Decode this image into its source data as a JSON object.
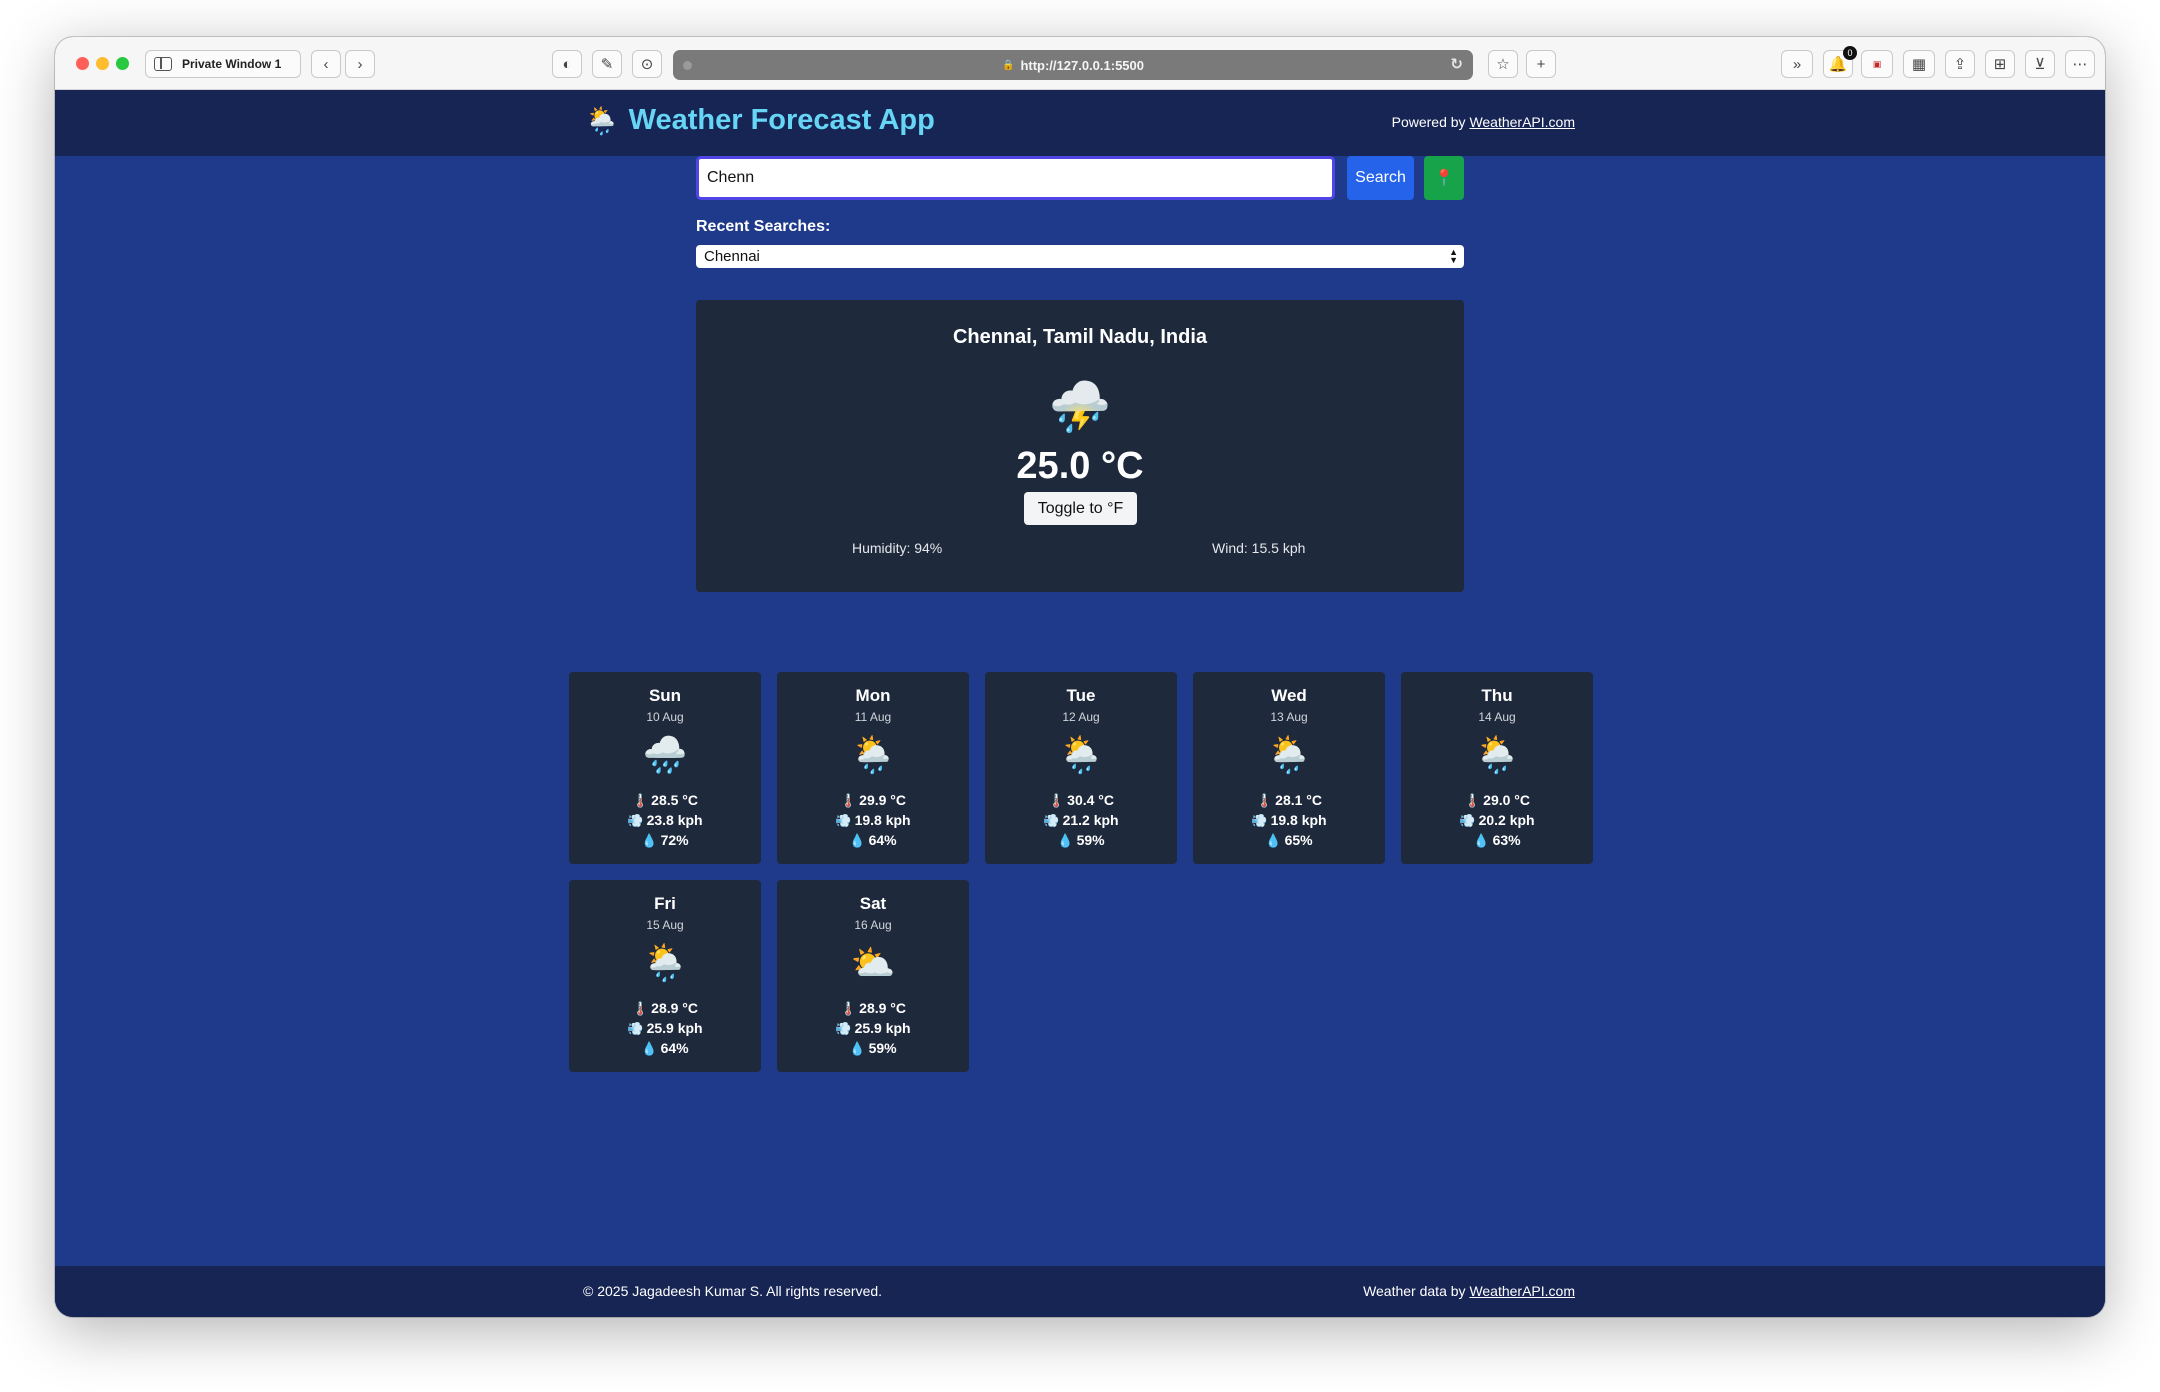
{
  "browser": {
    "tab_label": "Private Window 1",
    "url": "http://127.0.0.1:5500",
    "notification_count": "0"
  },
  "header": {
    "logo_icon": "🌦️",
    "title": "Weather Forecast App",
    "powered_prefix": "Powered by ",
    "powered_link": "WeatherAPI.com"
  },
  "search": {
    "value": "Chenn",
    "button_label": "Search",
    "location_icon": "📍"
  },
  "recent": {
    "label": "Recent Searches:",
    "selected": "Chennai"
  },
  "current": {
    "location": "Chennai, Tamil Nadu, India",
    "icon": "⛈️",
    "temperature": "25.0 °C",
    "toggle_label": "Toggle to °F",
    "humidity": "Humidity: 94%",
    "wind": "Wind: 15.5 kph"
  },
  "forecast": [
    {
      "day": "Sun",
      "date": "10 Aug",
      "icon": "🌧️",
      "temp": "28.5 °C",
      "wind": "23.8 kph",
      "humidity": "72%"
    },
    {
      "day": "Mon",
      "date": "11 Aug",
      "icon": "🌦️",
      "temp": "29.9 °C",
      "wind": "19.8 kph",
      "humidity": "64%"
    },
    {
      "day": "Tue",
      "date": "12 Aug",
      "icon": "🌦️",
      "temp": "30.4 °C",
      "wind": "21.2 kph",
      "humidity": "59%"
    },
    {
      "day": "Wed",
      "date": "13 Aug",
      "icon": "🌦️",
      "temp": "28.1 °C",
      "wind": "19.8 kph",
      "humidity": "65%"
    },
    {
      "day": "Thu",
      "date": "14 Aug",
      "icon": "🌦️",
      "temp": "29.0 °C",
      "wind": "20.2 kph",
      "humidity": "63%"
    },
    {
      "day": "Fri",
      "date": "15 Aug",
      "icon": "🌦️",
      "temp": "28.9 °C",
      "wind": "25.9 kph",
      "humidity": "64%"
    },
    {
      "day": "Sat",
      "date": "16 Aug",
      "icon": "⛅",
      "temp": "28.9 °C",
      "wind": "25.9 kph",
      "humidity": "59%"
    }
  ],
  "stat_icons": {
    "temp": "🌡️",
    "wind": "💨",
    "humidity": "💧"
  },
  "footer": {
    "copyright": "© 2025 Jagadeesh Kumar S. All rights reserved.",
    "data_prefix": "Weather data by ",
    "data_link": "WeatherAPI.com"
  },
  "colors": {
    "page_bg": "#1f3a8a",
    "header_bg": "#172554",
    "card_bg": "#1e293b",
    "title": "#67d5f5",
    "search_button": "#2563eb",
    "location_button": "#16a34a"
  }
}
